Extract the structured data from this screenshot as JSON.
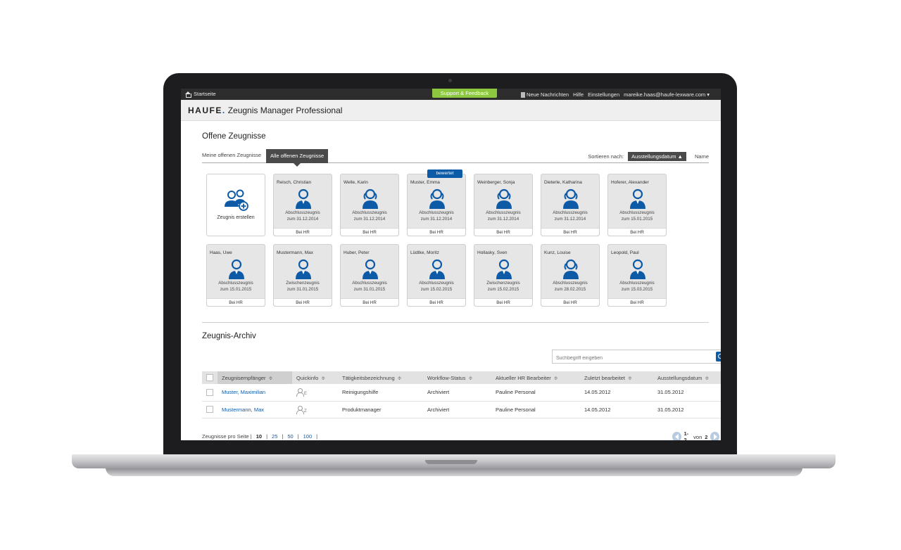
{
  "topbar": {
    "home_label": "Startseite",
    "support_label": "Support & Feedback",
    "nav": [
      "Neue Nachrichten",
      "Hilfe",
      "Einstellungen",
      "mareike.haas@haufe-lexware.com ▾"
    ]
  },
  "brand": {
    "logo": "HAUFE",
    "product": "Zeugnis Manager Professional"
  },
  "open": {
    "title": "Offene Zeugnisse",
    "tabs": [
      "Meine offenen Zeugnisse",
      "Alle offenen Zeugnisse"
    ],
    "sort_label": "Sortieren nach:",
    "sort_active": "Ausstellungsdatum ▲",
    "sort_other": "Name",
    "create_label": "Zeugnis erstellen",
    "badge": "bewertet",
    "cards": [
      {
        "name": "Reisch, Christian",
        "type": "Abschlusszeugnis",
        "date": "zum 31.12.2014",
        "status": "Bei HR",
        "gender": "m"
      },
      {
        "name": "Welle, Karin",
        "type": "Abschlusszeugnis",
        "date": "zum 31.12.2014",
        "status": "Bei HR",
        "gender": "f"
      },
      {
        "name": "Muster, Emma",
        "type": "Abschlusszeugnis",
        "date": "zum 31.12.2014",
        "status": "Bei HR",
        "gender": "f"
      },
      {
        "name": "Weinberger, Sonja",
        "type": "Abschlusszeugnis",
        "date": "zum 31.12.2014",
        "status": "Bei HR",
        "gender": "f"
      },
      {
        "name": "Dieterle, Katharina",
        "type": "Abschlusszeugnis",
        "date": "zum 31.12.2014",
        "status": "Bei HR",
        "gender": "f"
      },
      {
        "name": "Hoferer, Alexander",
        "type": "Abschlusszeugnis",
        "date": "zum 15.01.2015",
        "status": "Bei HR",
        "gender": "m"
      },
      {
        "name": "Haas, Uwe",
        "type": "Abschlusszeugnis",
        "date": "zum 15.01.2015",
        "status": "Bei HR",
        "gender": "m"
      },
      {
        "name": "Mustermann, Max",
        "type": "Zwischenzeugnis",
        "date": "zum 31.01.2015",
        "status": "Bei HR",
        "gender": "m"
      },
      {
        "name": "Huber, Peter",
        "type": "Abschlusszeugnis",
        "date": "zum 31.01.2015",
        "status": "Bei HR",
        "gender": "m"
      },
      {
        "name": "Lüdtke, Moritz",
        "type": "Abschlusszeugnis",
        "date": "zum 15.02.2015",
        "status": "Bei HR",
        "gender": "m"
      },
      {
        "name": "Hollasky, Sven",
        "type": "Zwischenzeugnis",
        "date": "zum 15.02.2015",
        "status": "Bei HR",
        "gender": "m"
      },
      {
        "name": "Kunz, Louise",
        "type": "Abschlusszeugnis",
        "date": "zum 28.02.2015",
        "status": "Bei HR",
        "gender": "f"
      },
      {
        "name": "Leopold, Paul",
        "type": "Abschlusszeugnis",
        "date": "zum 15.03.2015",
        "status": "Bei HR",
        "gender": "m"
      }
    ]
  },
  "archive": {
    "title": "Zeugnis-Archiv",
    "search_placeholder": "Suchbegriff eingeben",
    "columns": [
      "Zeugnisempfänger",
      "Quickinfo",
      "Tätigkeitsbezeichnung",
      "Workflow-Status",
      "Aktueller HR Bearbeiter",
      "Zuletzt bearbeitet",
      "Ausstellungsdatum"
    ],
    "sort_indicator": "≑",
    "rows": [
      {
        "name": "Muster, Maximilian",
        "quick": "E",
        "job": "Reinigungshilfe",
        "status": "Archiviert",
        "editor": "Pauline Personal",
        "last": "14.05.2012",
        "issued": "31.05.2012"
      },
      {
        "name": "Mustermann, Max",
        "quick": "Z",
        "job": "Produktmanager",
        "status": "Archiviert",
        "editor": "Pauline Personal",
        "last": "14.05.2012",
        "issued": "31.05.2012"
      }
    ],
    "pager_label": "Zeugnisse pro Seite |",
    "page_sizes": [
      "10",
      "25",
      "50",
      "100"
    ],
    "separator": "|",
    "range": "1-2",
    "of": "von",
    "total": "2"
  },
  "colors": {
    "accent": "#0d5aa7",
    "support": "#8dc63f",
    "topbar": "#2d2d2d"
  }
}
